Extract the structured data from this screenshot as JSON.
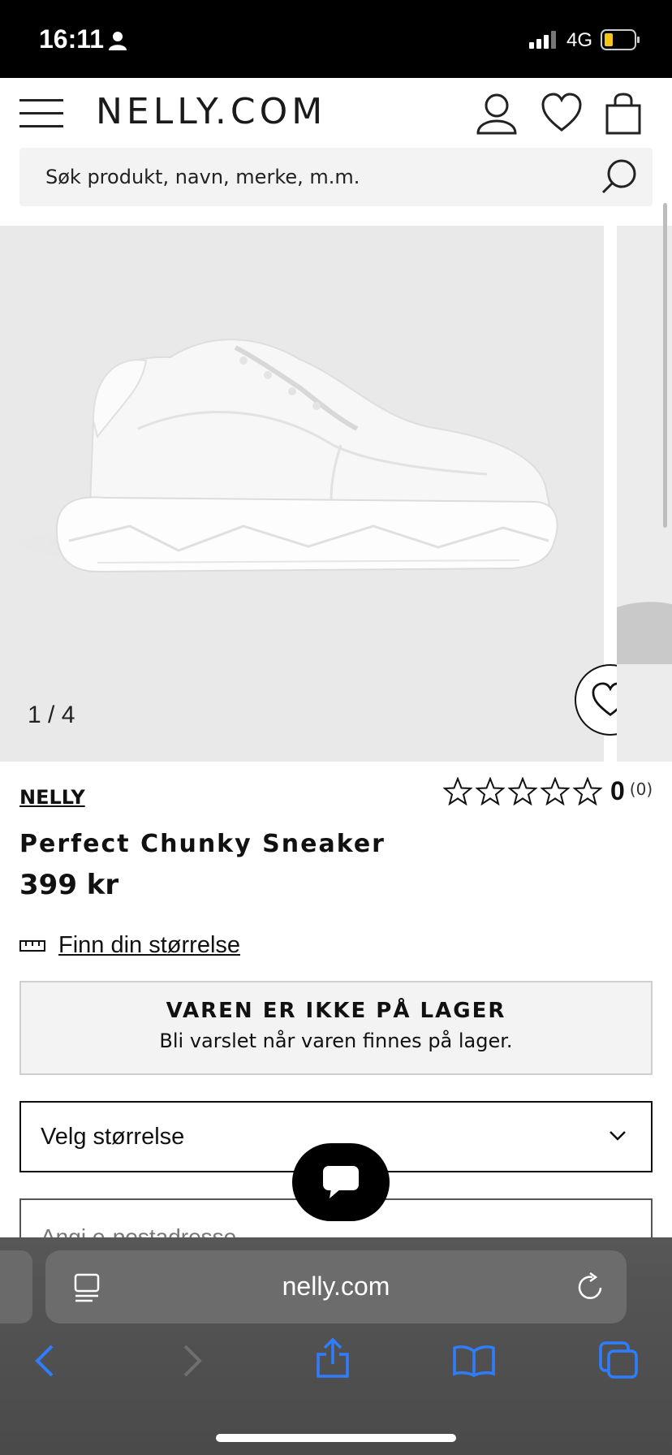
{
  "status_bar": {
    "time": "16:11",
    "network": "4G",
    "icons": [
      "person-icon",
      "signal-icon",
      "battery-icon"
    ]
  },
  "header": {
    "logo": "NELLY.COM",
    "icons": [
      "menu-icon",
      "account-icon",
      "wishlist-icon",
      "bag-icon"
    ]
  },
  "search": {
    "placeholder": "Søk produkt, navn, merke, m.m."
  },
  "gallery": {
    "counter": "1 / 4",
    "current": 1,
    "total": 4
  },
  "product": {
    "brand": "NELLY",
    "title": "Perfect Chunky Sneaker",
    "price": "399 kr",
    "rating": "0",
    "rating_count": "(0)",
    "stars_filled": 0,
    "stars_total": 5
  },
  "size_guide": {
    "label": "Finn din størrelse"
  },
  "stock": {
    "title": "VAREN ER IKKE PÅ LAGER",
    "subtitle": "Bli varslet når varen finnes på lager."
  },
  "size_select": {
    "label": "Velg størrelse"
  },
  "postal": {
    "placeholder": "Angi e-postadresse"
  },
  "browser": {
    "url": "nelly.com"
  },
  "colors": {
    "status_bar_bg": "#000000",
    "search_bg": "#f3f3f3",
    "browser_bg": "#4f4f4f",
    "ios_blue": "#2f7dff",
    "battery_yellow": "#f5c518"
  }
}
